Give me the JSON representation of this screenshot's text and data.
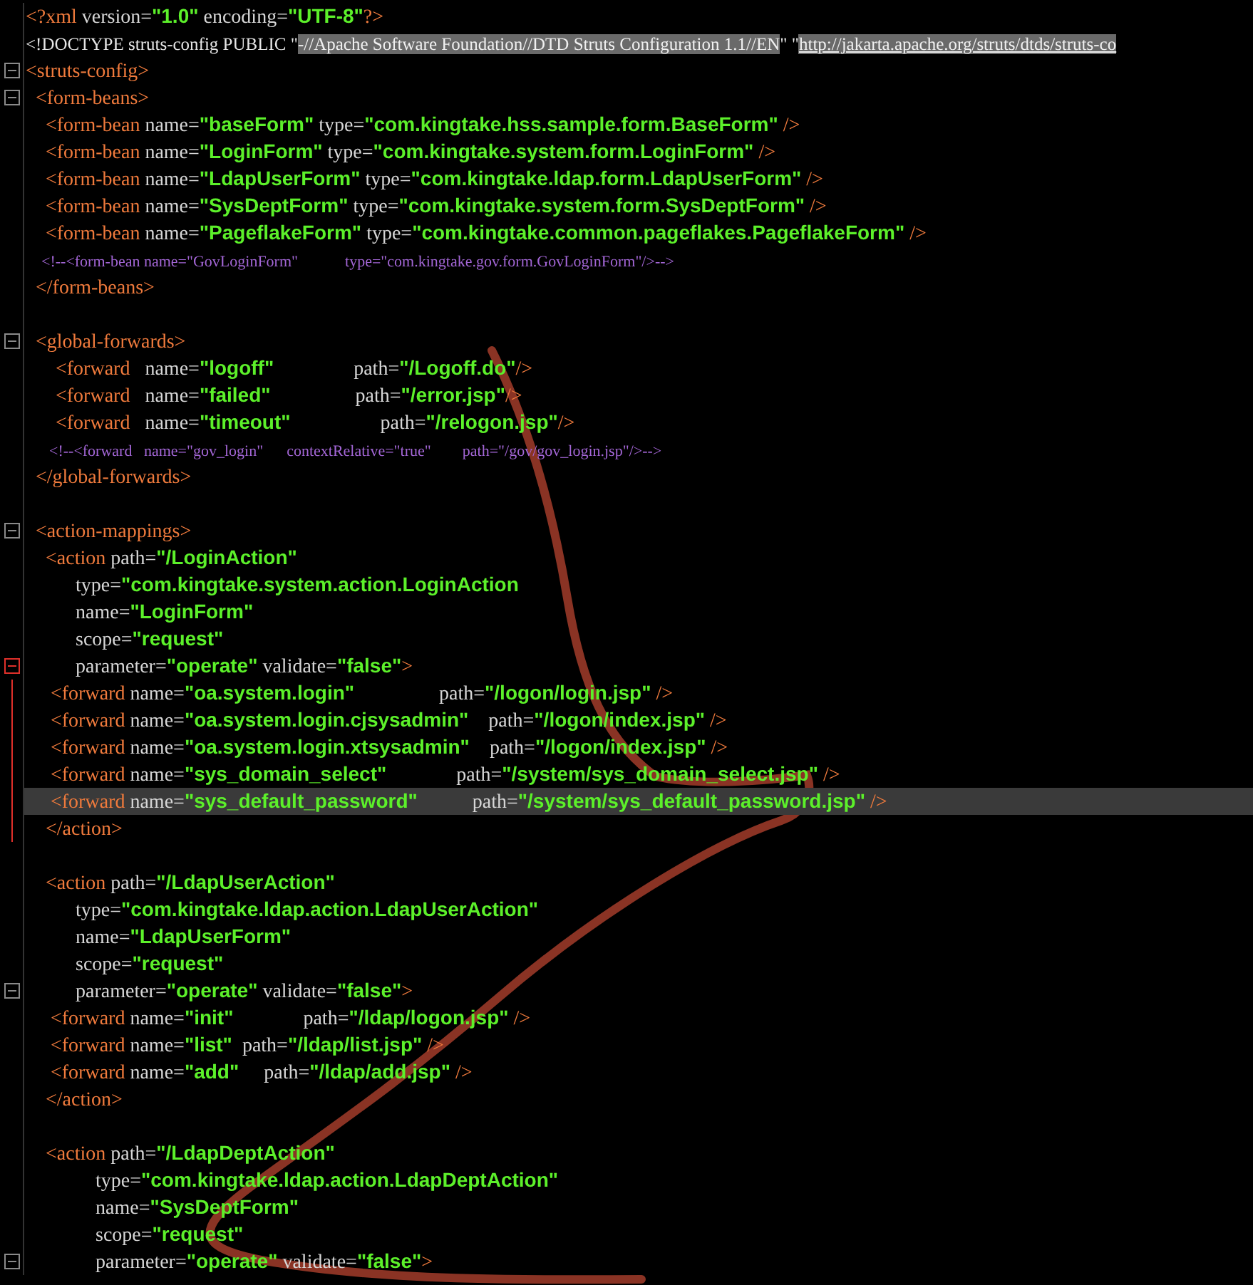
{
  "editor": {
    "blocks": [
      {
        "lines": [
          {
            "tokens": [
              {
                "kind": "tag",
                "text": "<?xml"
              },
              {
                "kind": "attr",
                "text": " version="
              },
              {
                "kind": "value",
                "text": "\"1.0\""
              },
              {
                "kind": "attr",
                "text": " encoding="
              },
              {
                "kind": "value",
                "text": "\"UTF-8\""
              },
              {
                "kind": "tag",
                "text": "?>"
              }
            ]
          },
          {
            "tokens": [
              {
                "kind": "plain",
                "text": "<!DOCTYPE struts-config PUBLIC \""
              },
              {
                "kind": "highlight",
                "text": "-//Apache Software Foundation//DTD Struts Configuration 1.1//EN"
              },
              {
                "kind": "plain",
                "text": "\" \""
              },
              {
                "kind": "link",
                "text": "http://jakarta.apache.org/struts/dtds/struts-co"
              }
            ]
          },
          {
            "fold": true,
            "tokens": [
              {
                "kind": "tag",
                "text": "<struts-config>"
              }
            ]
          },
          {
            "fold": true,
            "tokens": [
              {
                "kind": "tag",
                "text": "  <form-beans>"
              }
            ]
          },
          {
            "tokens": [
              {
                "kind": "tag",
                "text": "    <form-bean"
              },
              {
                "kind": "attr",
                "text": " name="
              },
              {
                "kind": "value",
                "text": "\"baseForm\""
              },
              {
                "kind": "attr",
                "text": " type="
              },
              {
                "kind": "value",
                "text": "\"com.kingtake.hss.sample.form.BaseForm\""
              },
              {
                "kind": "tag",
                "text": " />"
              }
            ]
          },
          {
            "tokens": [
              {
                "kind": "tag",
                "text": "    <form-bean"
              },
              {
                "kind": "attr",
                "text": " name="
              },
              {
                "kind": "value",
                "text": "\"LoginForm\""
              },
              {
                "kind": "attr",
                "text": " type="
              },
              {
                "kind": "value",
                "text": "\"com.kingtake.system.form.LoginForm\""
              },
              {
                "kind": "tag",
                "text": " />"
              }
            ]
          },
          {
            "tokens": [
              {
                "kind": "tag",
                "text": "    <form-bean"
              },
              {
                "kind": "attr",
                "text": " name="
              },
              {
                "kind": "value",
                "text": "\"LdapUserForm\""
              },
              {
                "kind": "attr",
                "text": " type="
              },
              {
                "kind": "value",
                "text": "\"com.kingtake.ldap.form.LdapUserForm\""
              },
              {
                "kind": "tag",
                "text": " />"
              }
            ]
          },
          {
            "tokens": [
              {
                "kind": "tag",
                "text": "    <form-bean"
              },
              {
                "kind": "attr",
                "text": " name="
              },
              {
                "kind": "value",
                "text": "\"SysDeptForm\""
              },
              {
                "kind": "attr",
                "text": " type="
              },
              {
                "kind": "value",
                "text": "\"com.kingtake.system.form.SysDeptForm\""
              },
              {
                "kind": "tag",
                "text": " />"
              }
            ]
          },
          {
            "tokens": [
              {
                "kind": "tag",
                "text": "    <form-bean"
              },
              {
                "kind": "attr",
                "text": " name="
              },
              {
                "kind": "value",
                "text": "\"PageflakeForm\""
              },
              {
                "kind": "attr",
                "text": " type="
              },
              {
                "kind": "value",
                "text": "\"com.kingtake.common.pageflakes.PageflakeForm\""
              },
              {
                "kind": "tag",
                "text": " />"
              }
            ]
          },
          {
            "tokens": [
              {
                "kind": "comment",
                "text": "    <!--<form-bean name=\"GovLoginForm\"            type=\"com.kingtake.gov.form.GovLoginForm\"/>-->"
              }
            ]
          },
          {
            "tokens": [
              {
                "kind": "tag",
                "text": "  </form-beans>"
              }
            ]
          }
        ]
      },
      {
        "lines": [
          {
            "fold": true,
            "tokens": [
              {
                "kind": "tag",
                "text": "  <global-forwards>"
              }
            ]
          },
          {
            "tokens": [
              {
                "kind": "tag",
                "text": "      <forward"
              },
              {
                "kind": "attr",
                "text": "   name="
              },
              {
                "kind": "value",
                "text": "\"logoff\""
              },
              {
                "kind": "attr",
                "text": "                path="
              },
              {
                "kind": "value",
                "text": "\"/Logoff.do\""
              },
              {
                "kind": "tag",
                "text": "/>"
              }
            ]
          },
          {
            "tokens": [
              {
                "kind": "tag",
                "text": "      <forward"
              },
              {
                "kind": "attr",
                "text": "   name="
              },
              {
                "kind": "value",
                "text": "\"failed\""
              },
              {
                "kind": "attr",
                "text": "                 path="
              },
              {
                "kind": "value",
                "text": "\"/error.jsp\""
              },
              {
                "kind": "tag",
                "text": "/>"
              }
            ]
          },
          {
            "tokens": [
              {
                "kind": "tag",
                "text": "      <forward"
              },
              {
                "kind": "attr",
                "text": "   name="
              },
              {
                "kind": "value",
                "text": "\"timeout\""
              },
              {
                "kind": "attr",
                "text": "                  path="
              },
              {
                "kind": "value",
                "text": "\"/relogon.jsp\""
              },
              {
                "kind": "tag",
                "text": "/>"
              }
            ]
          },
          {
            "tokens": [
              {
                "kind": "comment",
                "text": "      <!--<forward   name=\"gov_login\"      contextRelative=\"true\"        path=\"/gov/gov_login.jsp\"/>-->"
              }
            ]
          },
          {
            "tokens": [
              {
                "kind": "tag",
                "text": "  </global-forwards>"
              }
            ]
          }
        ]
      },
      {
        "lines": [
          {
            "fold": true,
            "tokens": [
              {
                "kind": "tag",
                "text": "  <action-mappings>"
              }
            ]
          },
          {
            "tokens": [
              {
                "kind": "tag",
                "text": "    <action"
              },
              {
                "kind": "attr",
                "text": " path="
              },
              {
                "kind": "value",
                "text": "\"/LoginAction\""
              }
            ]
          },
          {
            "tokens": [
              {
                "kind": "attr",
                "text": "          type="
              },
              {
                "kind": "value",
                "text": "\"com.kingtake.system.action.LoginAction"
              }
            ]
          },
          {
            "tokens": [
              {
                "kind": "attr",
                "text": "          name="
              },
              {
                "kind": "value",
                "text": "\"LoginForm\""
              }
            ]
          },
          {
            "tokens": [
              {
                "kind": "attr",
                "text": "          scope="
              },
              {
                "kind": "value",
                "text": "\"request\""
              }
            ]
          },
          {
            "fold": true,
            "modified": true,
            "tokens": [
              {
                "kind": "attr",
                "text": "          parameter="
              },
              {
                "kind": "value",
                "text": "\"operate\""
              },
              {
                "kind": "attr",
                "text": " validate="
              },
              {
                "kind": "value",
                "text": "\"false\""
              },
              {
                "kind": "tag",
                "text": ">"
              }
            ]
          },
          {
            "modified": true,
            "tokens": [
              {
                "kind": "tag",
                "text": "     <forward"
              },
              {
                "kind": "attr",
                "text": " name="
              },
              {
                "kind": "value",
                "text": "\"oa.system.login\""
              },
              {
                "kind": "attr",
                "text": "                 path="
              },
              {
                "kind": "value",
                "text": "\"/logon/login.jsp\""
              },
              {
                "kind": "tag",
                "text": " />"
              }
            ]
          },
          {
            "modified": true,
            "tokens": [
              {
                "kind": "tag",
                "text": "     <forward"
              },
              {
                "kind": "attr",
                "text": " name="
              },
              {
                "kind": "value",
                "text": "\"oa.system.login.cjsysadmin\""
              },
              {
                "kind": "attr",
                "text": "    path="
              },
              {
                "kind": "value",
                "text": "\"/logon/index.jsp\""
              },
              {
                "kind": "tag",
                "text": " />"
              }
            ]
          },
          {
            "modified": true,
            "tokens": [
              {
                "kind": "tag",
                "text": "     <forward"
              },
              {
                "kind": "attr",
                "text": " name="
              },
              {
                "kind": "value",
                "text": "\"oa.system.login.xtsysadmin\""
              },
              {
                "kind": "attr",
                "text": "    path="
              },
              {
                "kind": "value",
                "text": "\"/logon/index.jsp\""
              },
              {
                "kind": "tag",
                "text": " />"
              }
            ]
          },
          {
            "modified": true,
            "tokens": [
              {
                "kind": "tag",
                "text": "     <forward"
              },
              {
                "kind": "attr",
                "text": " name="
              },
              {
                "kind": "value",
                "text": "\"sys_domain_select\""
              },
              {
                "kind": "attr",
                "text": "              path="
              },
              {
                "kind": "value",
                "text": "\"/system/sys_domain_select.jsp\""
              },
              {
                "kind": "tag",
                "text": " />"
              }
            ]
          },
          {
            "modified": true,
            "current": true,
            "tokens": [
              {
                "kind": "tag",
                "text": "     <forward"
              },
              {
                "kind": "attr",
                "text": " name="
              },
              {
                "kind": "value",
                "text": "\"sys_default_password\""
              },
              {
                "kind": "attr",
                "text": "           path="
              },
              {
                "kind": "value",
                "text": "\"/system/sys_default_password.jsp\""
              },
              {
                "kind": "tag",
                "text": " />"
              }
            ]
          },
          {
            "modified": true,
            "tokens": [
              {
                "kind": "tag",
                "text": "    </action>"
              }
            ]
          }
        ]
      },
      {
        "lines": [
          {
            "tokens": [
              {
                "kind": "tag",
                "text": "    <action"
              },
              {
                "kind": "attr",
                "text": " path="
              },
              {
                "kind": "value",
                "text": "\"/LdapUserAction\""
              }
            ]
          },
          {
            "tokens": [
              {
                "kind": "attr",
                "text": "          type="
              },
              {
                "kind": "value",
                "text": "\"com.kingtake.ldap.action.LdapUserAction\""
              }
            ]
          },
          {
            "tokens": [
              {
                "kind": "attr",
                "text": "          name="
              },
              {
                "kind": "value",
                "text": "\"LdapUserForm\""
              }
            ]
          },
          {
            "tokens": [
              {
                "kind": "attr",
                "text": "          scope="
              },
              {
                "kind": "value",
                "text": "\"request\""
              }
            ]
          },
          {
            "fold": true,
            "tokens": [
              {
                "kind": "attr",
                "text": "          parameter="
              },
              {
                "kind": "value",
                "text": "\"operate\""
              },
              {
                "kind": "attr",
                "text": " validate="
              },
              {
                "kind": "value",
                "text": "\"false\""
              },
              {
                "kind": "tag",
                "text": ">"
              }
            ]
          },
          {
            "tokens": [
              {
                "kind": "tag",
                "text": "     <forward"
              },
              {
                "kind": "attr",
                "text": " name="
              },
              {
                "kind": "value",
                "text": "\"init\""
              },
              {
                "kind": "attr",
                "text": "              path="
              },
              {
                "kind": "value",
                "text": "\"/ldap/logon.jsp\""
              },
              {
                "kind": "tag",
                "text": " />"
              }
            ]
          },
          {
            "tokens": [
              {
                "kind": "tag",
                "text": "     <forward"
              },
              {
                "kind": "attr",
                "text": " name="
              },
              {
                "kind": "value",
                "text": "\"list\""
              },
              {
                "kind": "attr",
                "text": "  path="
              },
              {
                "kind": "value",
                "text": "\"/ldap/list.jsp\""
              },
              {
                "kind": "tag",
                "text": " />"
              }
            ]
          },
          {
            "tokens": [
              {
                "kind": "tag",
                "text": "     <forward"
              },
              {
                "kind": "attr",
                "text": " name="
              },
              {
                "kind": "value",
                "text": "\"add\""
              },
              {
                "kind": "attr",
                "text": "     path="
              },
              {
                "kind": "value",
                "text": "\"/ldap/add.jsp\""
              },
              {
                "kind": "tag",
                "text": " />"
              }
            ]
          },
          {
            "tokens": [
              {
                "kind": "tag",
                "text": "    </action>"
              }
            ]
          }
        ]
      },
      {
        "lines": [
          {
            "tokens": [
              {
                "kind": "tag",
                "text": "    <action"
              },
              {
                "kind": "attr",
                "text": " path="
              },
              {
                "kind": "value",
                "text": "\"/LdapDeptAction\""
              }
            ]
          },
          {
            "tokens": [
              {
                "kind": "attr",
                "text": "              type="
              },
              {
                "kind": "value",
                "text": "\"com.kingtake.ldap.action.LdapDeptAction\""
              }
            ]
          },
          {
            "tokens": [
              {
                "kind": "attr",
                "text": "              name="
              },
              {
                "kind": "value",
                "text": "\"SysDeptForm\""
              }
            ]
          },
          {
            "tokens": [
              {
                "kind": "attr",
                "text": "              scope="
              },
              {
                "kind": "value",
                "text": "\"request\""
              }
            ]
          },
          {
            "fold": true,
            "tokens": [
              {
                "kind": "attr",
                "text": "              parameter="
              },
              {
                "kind": "value",
                "text": "\"operate\""
              },
              {
                "kind": "attr",
                "text": " validate="
              },
              {
                "kind": "value",
                "text": "\"false\""
              },
              {
                "kind": "tag",
                "text": ">"
              }
            ]
          }
        ]
      }
    ]
  }
}
